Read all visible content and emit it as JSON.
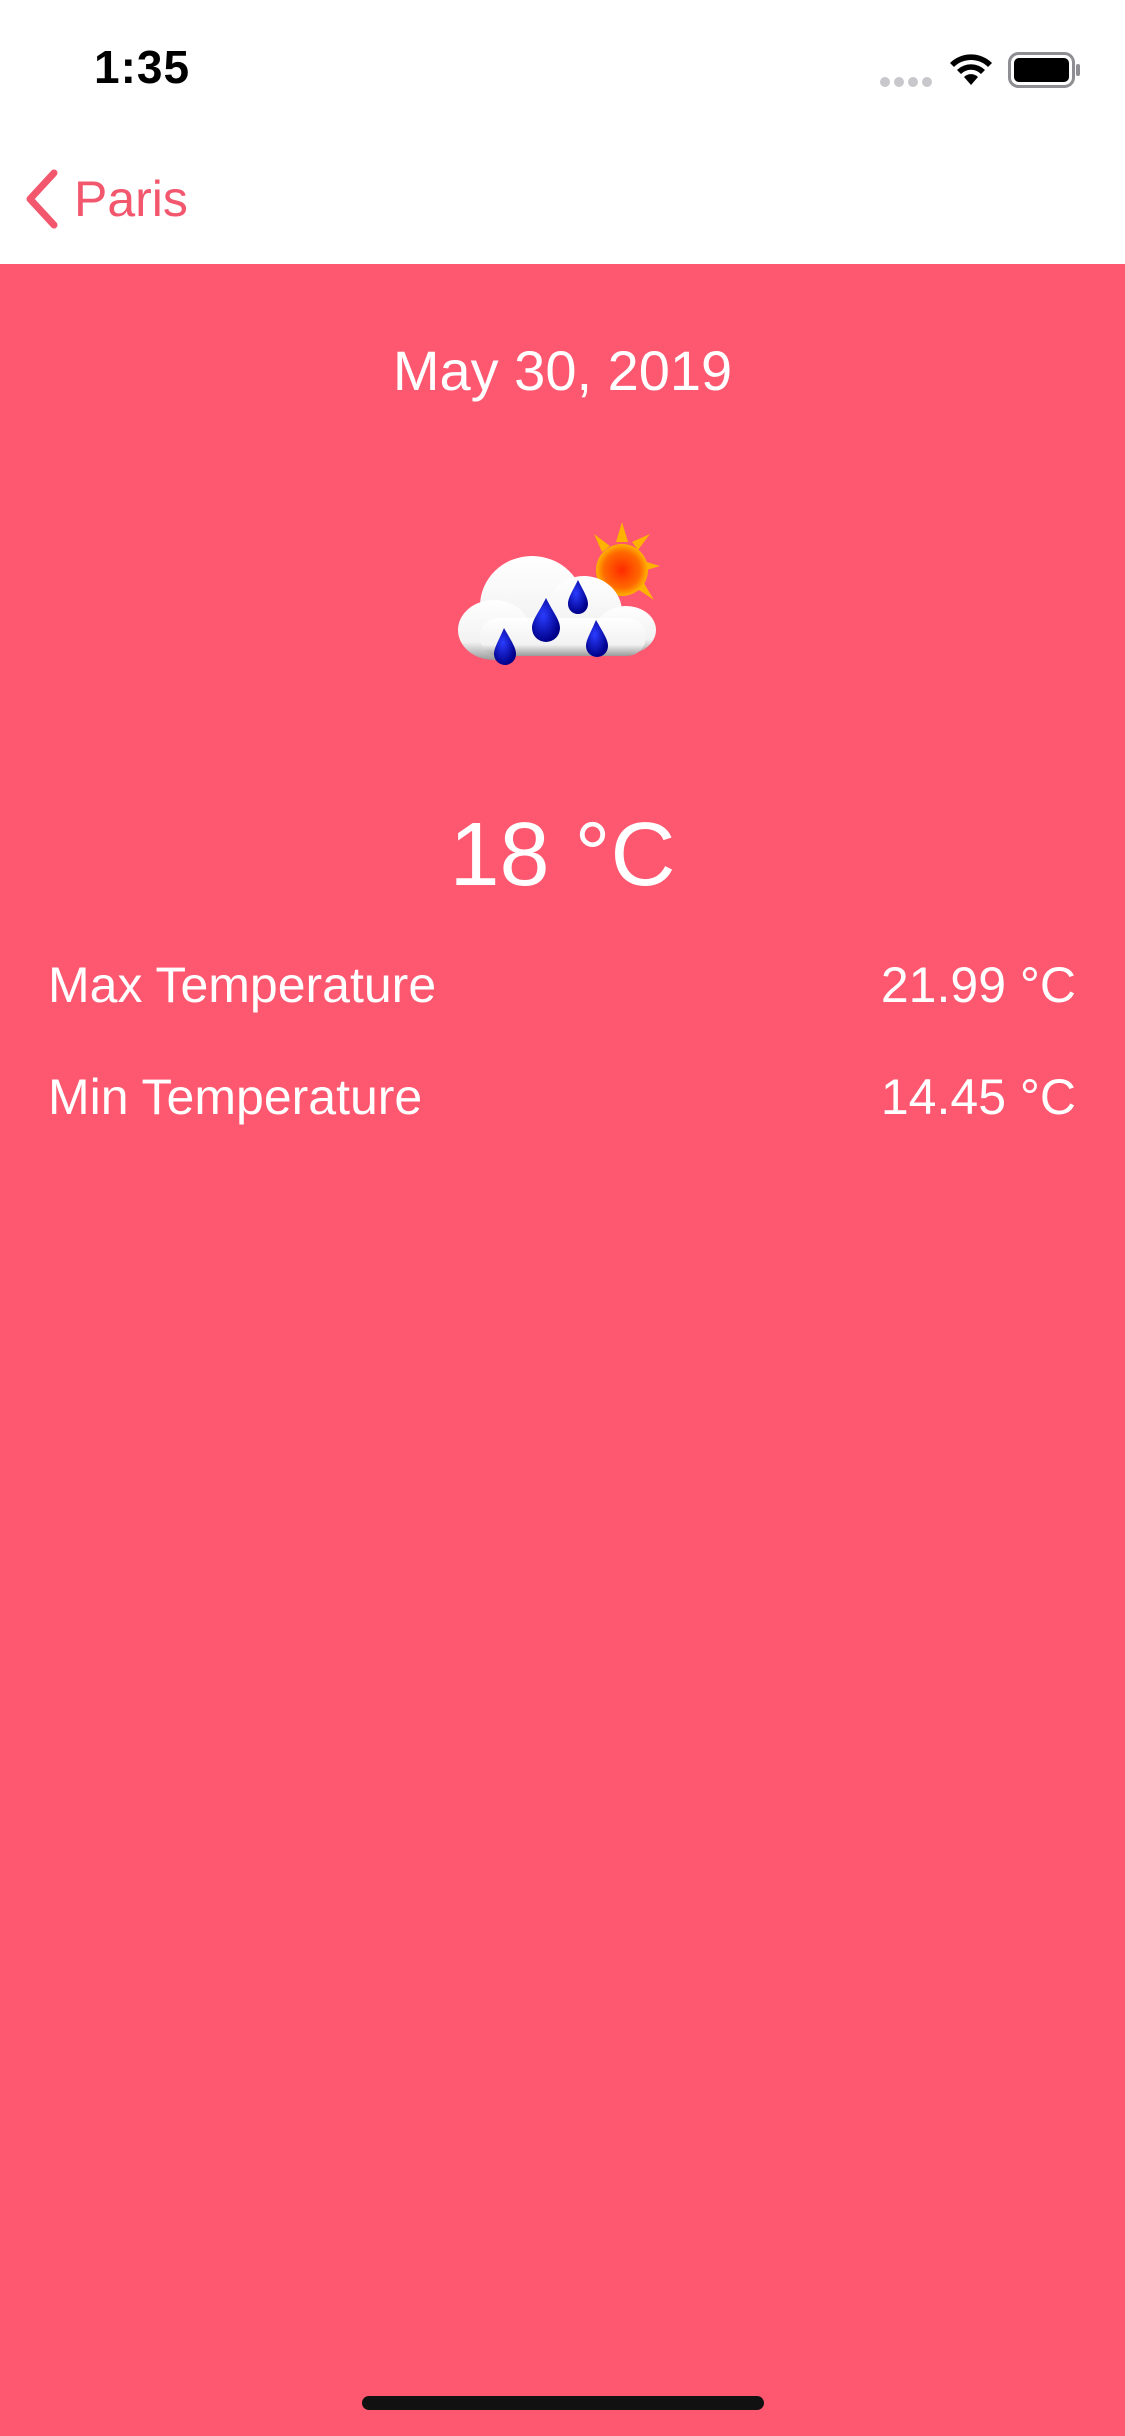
{
  "status_bar": {
    "time": "1:35"
  },
  "nav": {
    "back_label": "Paris"
  },
  "weather": {
    "date": "May 30, 2019",
    "icon": "cloud-rain-sun-icon",
    "current_temp": "18 °C",
    "details": [
      {
        "label": "Max Temperature",
        "value": "21.99 °C"
      },
      {
        "label": "Min Temperature",
        "value": "14.45 °C"
      }
    ]
  },
  "colors": {
    "accent": "#f2576e",
    "background": "#fd5870",
    "text": "#ffffff"
  }
}
